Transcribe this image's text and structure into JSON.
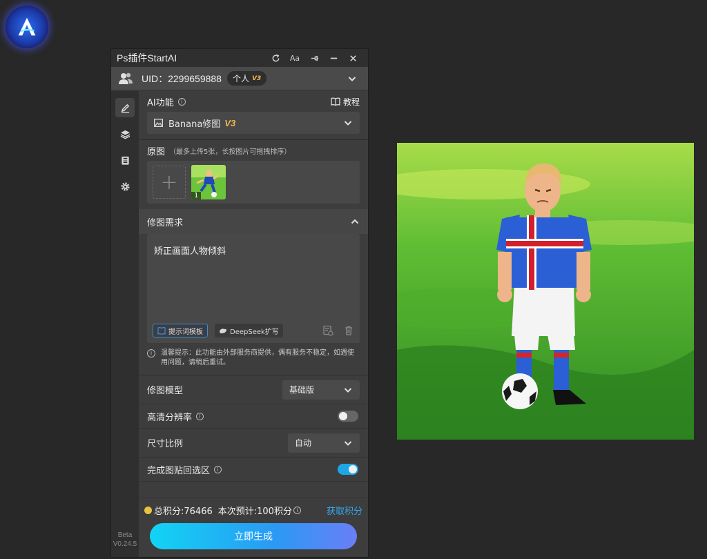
{
  "window": {
    "title": "Ps插件StartAI",
    "buttons": [
      "refresh-icon",
      "font-size-icon",
      "pin-icon",
      "minimize-icon",
      "close-icon"
    ]
  },
  "account": {
    "uid_label": "UID：2299659888",
    "plan_label": "个人",
    "plan_version": "V3"
  },
  "sidebar": {
    "items": [
      "brush-icon",
      "layers-icon",
      "save-icon",
      "settings-icon"
    ],
    "beta_label": "Beta",
    "version": "V0.24.5"
  },
  "ai_function": {
    "label": "AI功能",
    "tutorial_label": "教程",
    "selected": "Banana修图",
    "selected_version": "V3"
  },
  "source_image": {
    "label": "原图",
    "hint": "（最多上传5张，长按图片可拖拽排序）",
    "add_symbol": "+",
    "thumbnails": [
      {
        "index": "1"
      }
    ]
  },
  "edit_request": {
    "label": "修图需求",
    "prompt_text": "矫正画面人物倾斜",
    "template_button": "提示词模板",
    "deepseek_button": "DeepSeek扩写",
    "notice": "温馨提示：此功能由外部服务商提供，偶有服务不稳定，如遇使用问题，请稍后重试。"
  },
  "options": {
    "model_label": "修图模型",
    "model_value": "基础版",
    "hd_label": "高清分辨率",
    "hd_enabled": false,
    "ratio_label": "尺寸比例",
    "ratio_value": "自动",
    "paste_back_label": "完成图贴回选区",
    "paste_back_enabled": true
  },
  "footer": {
    "total_points": "总积分:76466",
    "estimate": "本次预计:100积分",
    "get_points": "获取积分",
    "generate_button": "立即生成"
  },
  "colors": {
    "accent": "#1ea7e8",
    "version_badge": "#f2b84b",
    "link": "#33aaf0"
  }
}
